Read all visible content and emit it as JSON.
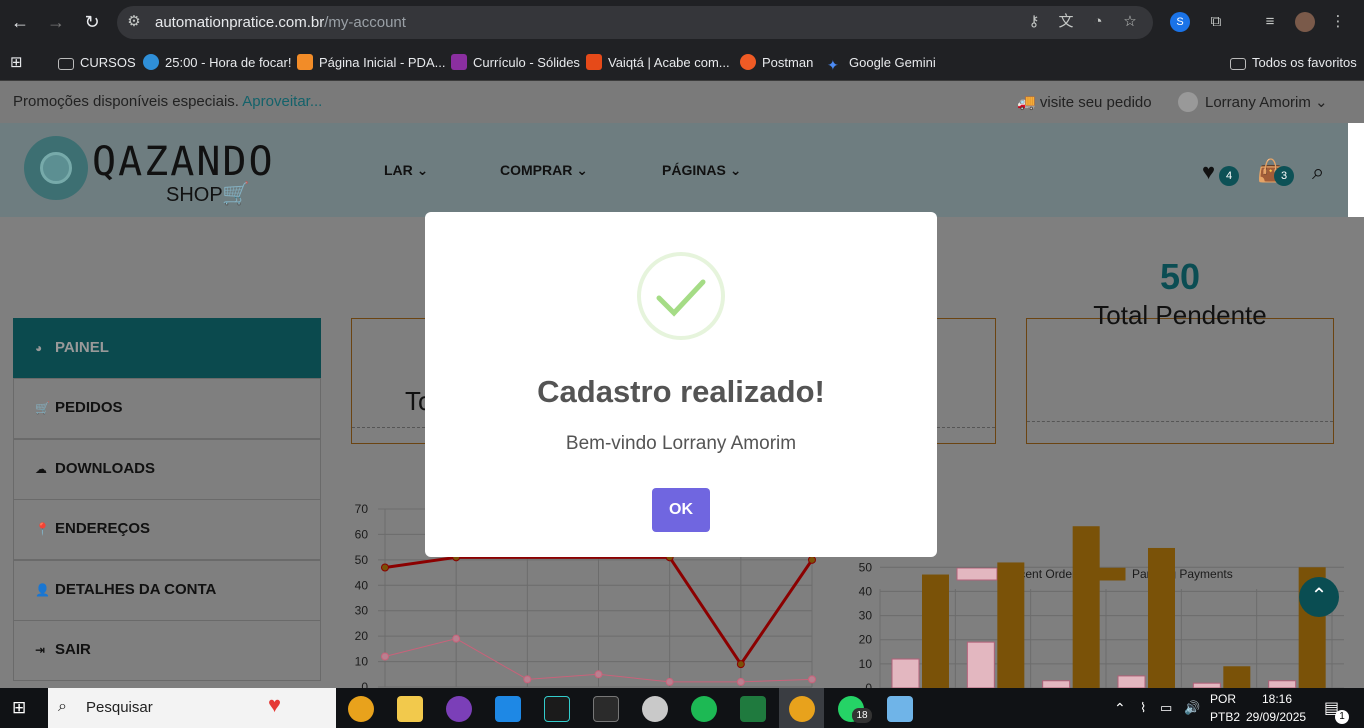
{
  "browser": {
    "url_host": "automationpratice.com.br",
    "url_path": "/my-account",
    "bookmarks": [
      {
        "label": "CURSOS",
        "color": "#bbbbbb"
      },
      {
        "label": "25:00 - Hora de focar!",
        "color": "#2f8fd8"
      },
      {
        "label": "Página Inicial - PDA...",
        "color": "#f28c28"
      },
      {
        "label": "Currículo - Sólides",
        "color": "#8b2fa0"
      },
      {
        "label": "Vaiqtá | Acabe com...",
        "color": "#e64a19"
      },
      {
        "label": "Postman",
        "color": "#ef5b25"
      },
      {
        "label": "Google Gemini",
        "color": "#4c8bf5"
      }
    ],
    "all_favorites": "Todos os favoritos"
  },
  "promo": {
    "text": "Promoções disponíveis especiais.",
    "link": "Aproveitar..."
  },
  "header": {
    "track_order": "visite seu pedido",
    "user_name": "Lorrany Amorim",
    "logo_text": "QAZANDO",
    "logo_shop": "SHOP",
    "menu": [
      "LAR",
      "COMPRAR",
      "PÁGINAS"
    ],
    "wishlist_count": "4",
    "cart_count": "3"
  },
  "sidebar": {
    "items": [
      {
        "label": "PAINEL",
        "icon": "dashboard-icon"
      },
      {
        "label": "PEDIDOS",
        "icon": "cart-icon"
      },
      {
        "label": "DOWNLOADS",
        "icon": "cloud-download-icon"
      },
      {
        "label": "ENDEREÇOS",
        "icon": "map-pin-icon"
      },
      {
        "label": "DETALHES DA CONTA",
        "icon": "user-icon"
      },
      {
        "label": "SAIR",
        "icon": "sign-out-icon"
      }
    ]
  },
  "cards": {
    "card1_label": "To",
    "card3_value": "50",
    "card3_label": "Total Pendente"
  },
  "chart_data": [
    {
      "type": "line",
      "ylim": [
        0,
        70
      ],
      "yticks": [
        0,
        10,
        20,
        30,
        40,
        50,
        60,
        70
      ],
      "series": [
        {
          "color": "#8b0000",
          "points": [
            [
              0,
              47
            ],
            [
              1,
              51
            ],
            [
              4,
              51
            ],
            [
              5,
              9
            ],
            [
              6,
              50
            ]
          ]
        },
        {
          "color": "#c9627a",
          "points": [
            [
              0,
              12
            ],
            [
              1,
              19
            ],
            [
              2,
              3
            ],
            [
              3,
              5
            ],
            [
              4,
              2
            ],
            [
              5,
              2
            ],
            [
              6,
              3
            ]
          ]
        }
      ]
    },
    {
      "type": "bar",
      "ylim": [
        0,
        70
      ],
      "yticks": [
        0,
        10,
        20,
        30,
        40,
        50
      ],
      "series": [
        {
          "name": "Recent Order",
          "color": "#e3b7c0",
          "values": [
            12,
            19,
            3,
            5,
            2,
            3
          ]
        },
        {
          "name": "Panding Payments",
          "color": "#7a5208",
          "values": [
            47,
            52,
            67,
            58,
            9,
            50
          ]
        }
      ]
    }
  ],
  "modal": {
    "title": "Cadastro realizado!",
    "message": "Bem-vindo Lorrany Amorim",
    "ok_label": "OK"
  },
  "taskbar": {
    "search_placeholder": "Pesquisar",
    "whatsapp_badge": "18",
    "lang_top": "POR",
    "lang_bottom": "PTB2",
    "time": "18:16",
    "date": "29/09/2025",
    "notification_count": "1"
  }
}
